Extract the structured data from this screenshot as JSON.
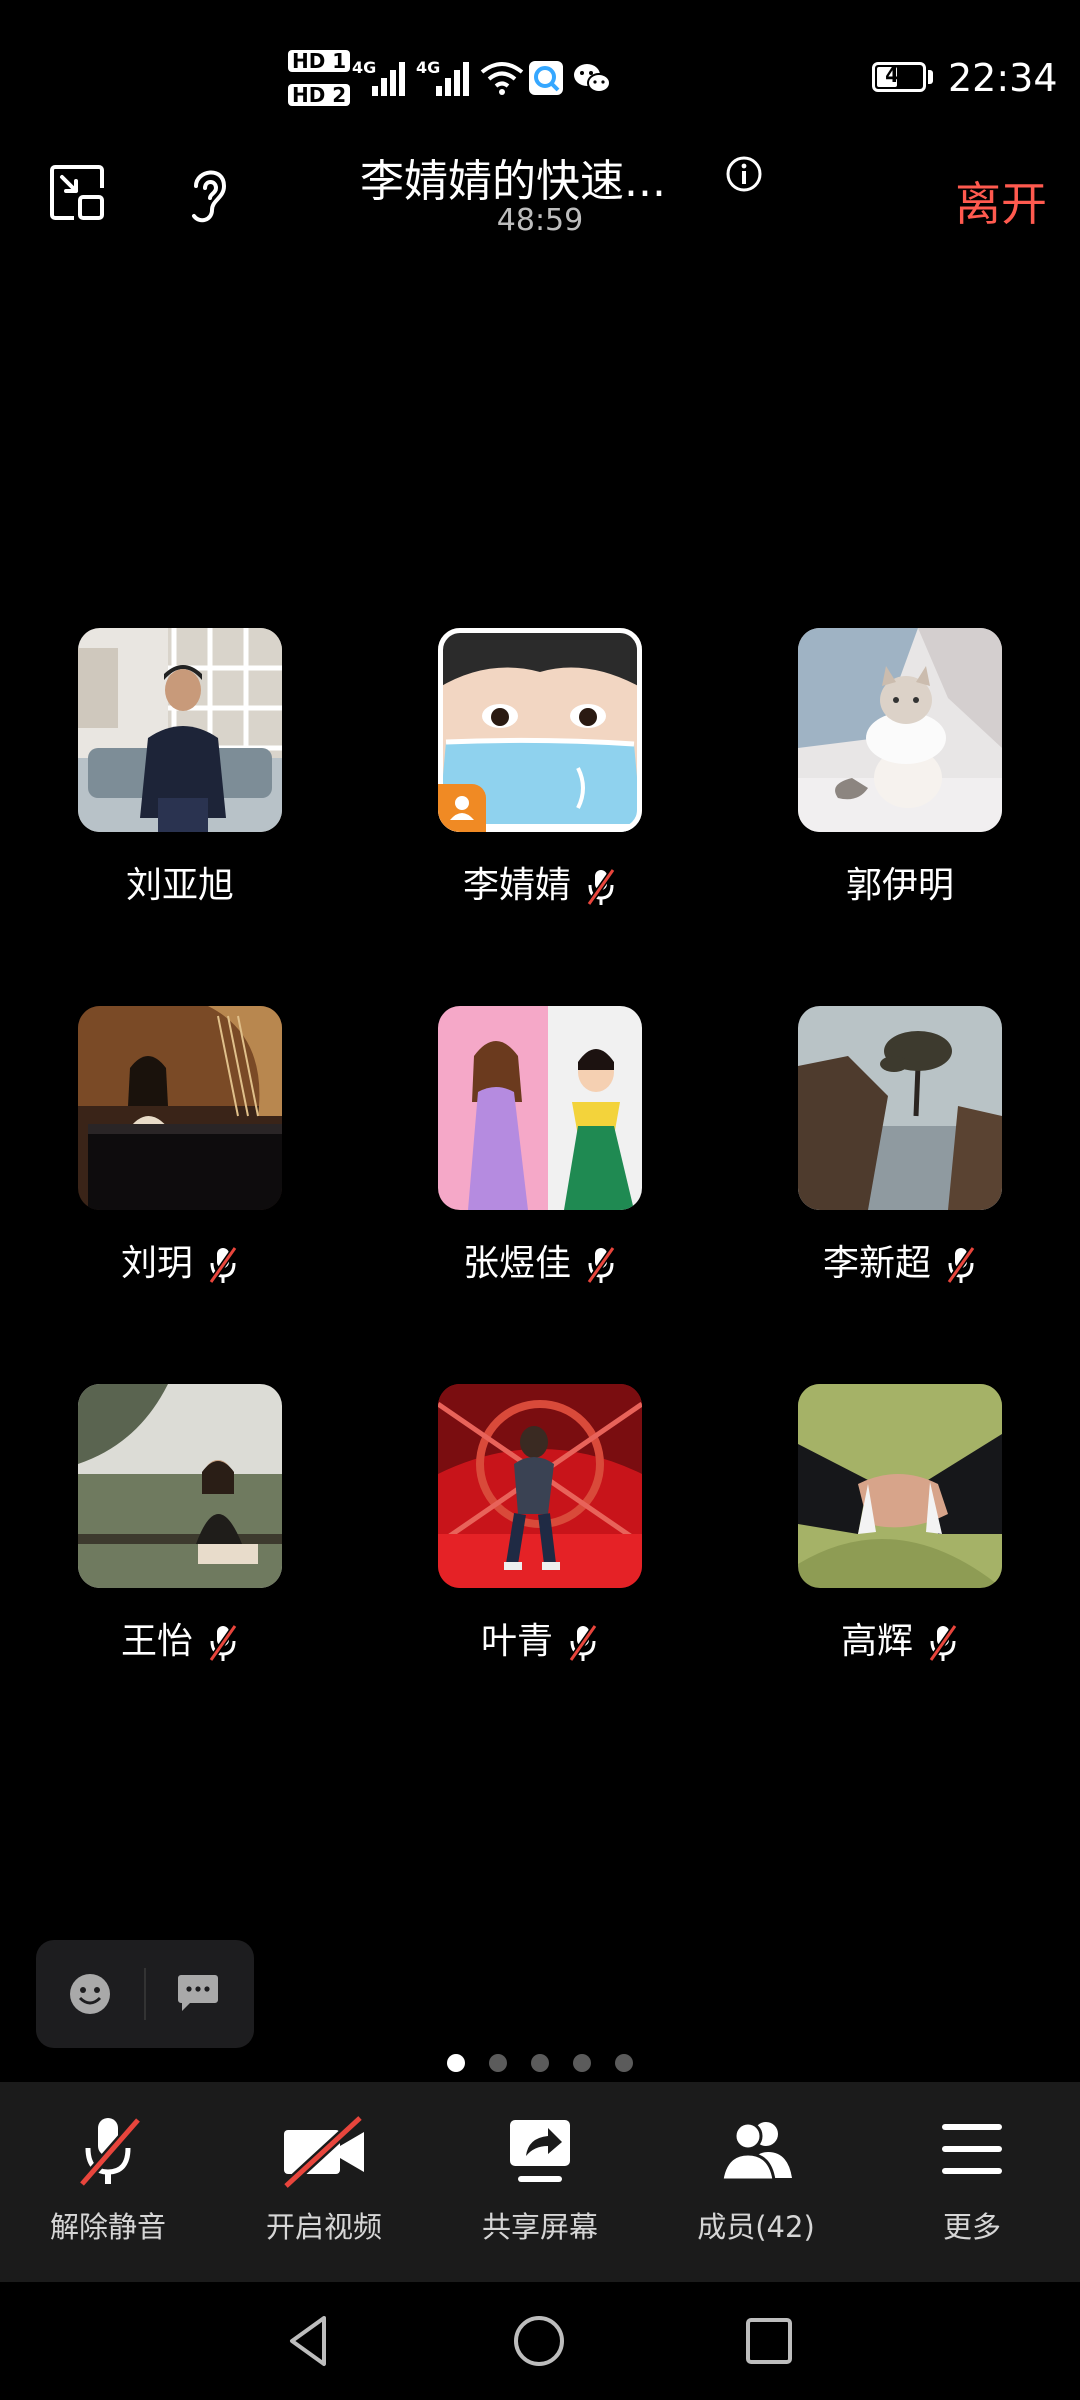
{
  "status_bar": {
    "hd1": "HD 1",
    "hd2": "HD 2",
    "net1": "4G",
    "net2": "4G",
    "battery": "41",
    "time": "22:34"
  },
  "header": {
    "title": "李婧婧的快速...",
    "elapsed": "48:59",
    "leave_label": "离开"
  },
  "participants": [
    {
      "name": "刘亚旭",
      "muted": false,
      "host": false
    },
    {
      "name": "李婧婧",
      "muted": true,
      "host": true
    },
    {
      "name": "郭伊明",
      "muted": false,
      "host": false
    },
    {
      "name": "刘玥",
      "muted": true,
      "host": false
    },
    {
      "name": "张煜佳",
      "muted": true,
      "host": false
    },
    {
      "name": "李新超",
      "muted": true,
      "host": false
    },
    {
      "name": "王怡",
      "muted": true,
      "host": false
    },
    {
      "name": "叶青",
      "muted": true,
      "host": false
    },
    {
      "name": "高辉",
      "muted": true,
      "host": false
    }
  ],
  "pager": {
    "count": 5,
    "active": 1
  },
  "toolbar": {
    "unmute": "解除静音",
    "video": "开启视频",
    "share": "共享屏幕",
    "members": "成员(42)",
    "more": "更多"
  },
  "colors": {
    "leave": "#ff5a4f",
    "mute_slash": "#e8453c",
    "host_badge": "#f08a24",
    "toolbar_bg": "#1b1b1b"
  }
}
